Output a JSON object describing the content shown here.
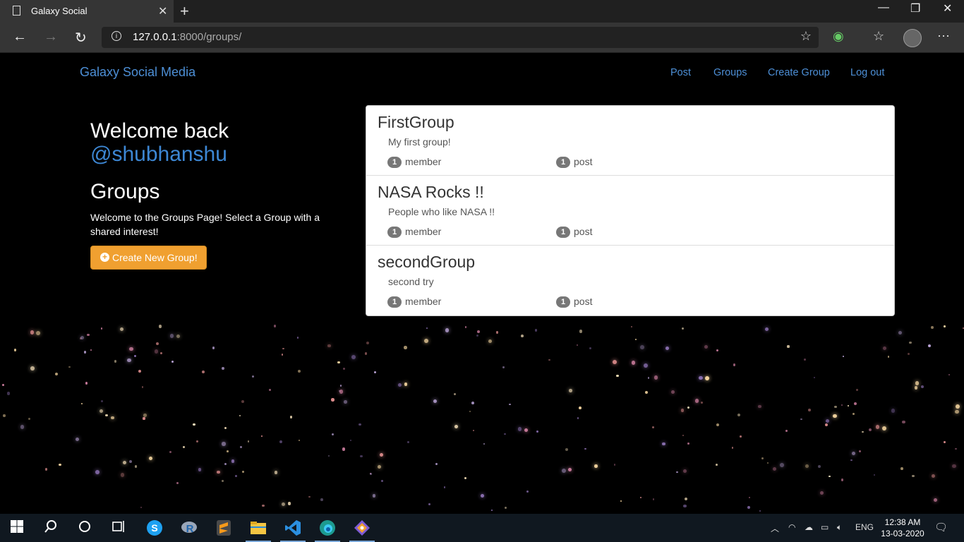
{
  "browser": {
    "tab_title": "Galaxy Social",
    "url_host": "127.0.0.1",
    "url_rest": ":8000/groups/"
  },
  "nav": {
    "brand": "Galaxy Social Media",
    "links": [
      "Post",
      "Groups",
      "Create Group",
      "Log out"
    ]
  },
  "sidebar": {
    "welcome": "Welcome back",
    "username": "@shubhanshu",
    "heading": "Groups",
    "intro": "Welcome to the Groups Page! Select a Group with a shared interest!",
    "create_button": "Create New Group!"
  },
  "groups": [
    {
      "name": "FirstGroup",
      "description": "My first group!",
      "members": "1",
      "member_label": "member",
      "posts": "1",
      "post_label": "post"
    },
    {
      "name": "NASA Rocks !!",
      "description": "People who like NASA !!",
      "members": "1",
      "member_label": "member",
      "posts": "1",
      "post_label": "post"
    },
    {
      "name": "secondGroup",
      "description": "second try",
      "members": "1",
      "member_label": "member",
      "posts": "1",
      "post_label": "post"
    }
  ],
  "taskbar": {
    "lang": "ENG",
    "time": "12:38 AM",
    "date": "13-03-2020"
  },
  "colors": {
    "link": "#4d8fd6",
    "button": "#f0a030",
    "badge": "#777777"
  }
}
